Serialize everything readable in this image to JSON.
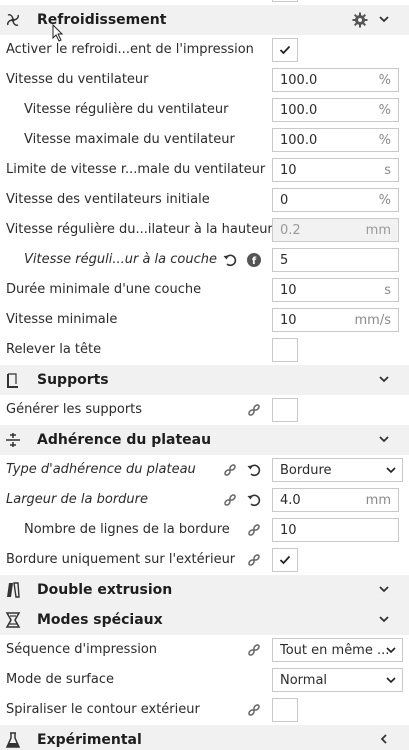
{
  "sections": {
    "cooling": "Refroidissement",
    "support": "Supports",
    "adhesion": "Adhérence du plateau",
    "dual": "Double extrusion",
    "special": "Modes spéciaux",
    "experimental": "Expérimental"
  },
  "cooling": {
    "enable_label": "Activer le refroidi...ent de l'impression",
    "enable_checked": true,
    "fan_speed": {
      "label": "Vitesse du ventilateur",
      "value": "100.0",
      "unit": "%"
    },
    "fan_regular": {
      "label": "Vitesse régulière du ventilateur",
      "value": "100.0",
      "unit": "%"
    },
    "fan_max": {
      "label": "Vitesse maximale du ventilateur",
      "value": "100.0",
      "unit": "%"
    },
    "fan_limit": {
      "label": "Limite de vitesse r...male du ventilateur",
      "value": "10",
      "unit": "s"
    },
    "fan_initial": {
      "label": "Vitesse des ventilateurs initiale",
      "value": "0",
      "unit": "%"
    },
    "fan_height": {
      "label": "Vitesse régulière du...ilateur à la hauteur",
      "value": "0.2",
      "unit": "mm"
    },
    "fan_layer": {
      "label": "Vitesse réguli...ur à la couche",
      "value": "5"
    },
    "min_layer_time": {
      "label": "Durée minimale d'une couche",
      "value": "10",
      "unit": "s"
    },
    "min_speed": {
      "label": "Vitesse minimale",
      "value": "10",
      "unit": "mm/s"
    },
    "lift_head": {
      "label": "Relever la tête",
      "checked": false
    }
  },
  "support": {
    "generate": {
      "label": "Générer les supports",
      "checked": false
    }
  },
  "adhesion": {
    "type": {
      "label": "Type d'adhérence du plateau",
      "value": "Bordure"
    },
    "brim_width": {
      "label": "Largeur de la bordure",
      "value": "4.0",
      "unit": "mm"
    },
    "brim_lines": {
      "label": "Nombre de lignes de la bordure",
      "value": "10"
    },
    "brim_outside": {
      "label": "Bordure uniquement sur l'extérieur",
      "checked": true
    }
  },
  "special": {
    "sequence": {
      "label": "Séquence d'impression",
      "value": "Tout en même ..."
    },
    "surface": {
      "label": "Mode de surface",
      "value": "Normal"
    },
    "spiralize": {
      "label": "Spiraliser le contour extérieur",
      "checked": false
    }
  },
  "colors": {
    "section_bg": "#f1f1f1",
    "field_border": "#c9c9c9",
    "icon": "#555555"
  }
}
